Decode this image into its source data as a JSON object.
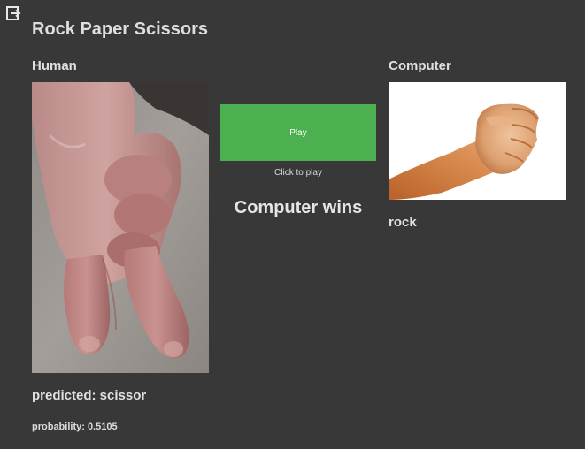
{
  "app": {
    "title": "Rock Paper Scissors"
  },
  "human": {
    "heading": "Human",
    "image_icon": "scissors-hand-photo",
    "predicted_label": "predicted: scissor",
    "probability_label": "probability: 0.5105"
  },
  "computer": {
    "heading": "Computer",
    "image_icon": "rock-fist-photo",
    "choice": "rock"
  },
  "controls": {
    "play_label": "Play",
    "hint": "Click to play",
    "button_color": "#4caf50"
  },
  "result": {
    "text": "Computer wins"
  },
  "icons": {
    "exit": "exit-icon"
  },
  "colors": {
    "background": "#383838",
    "text": "#e6e6e6"
  }
}
